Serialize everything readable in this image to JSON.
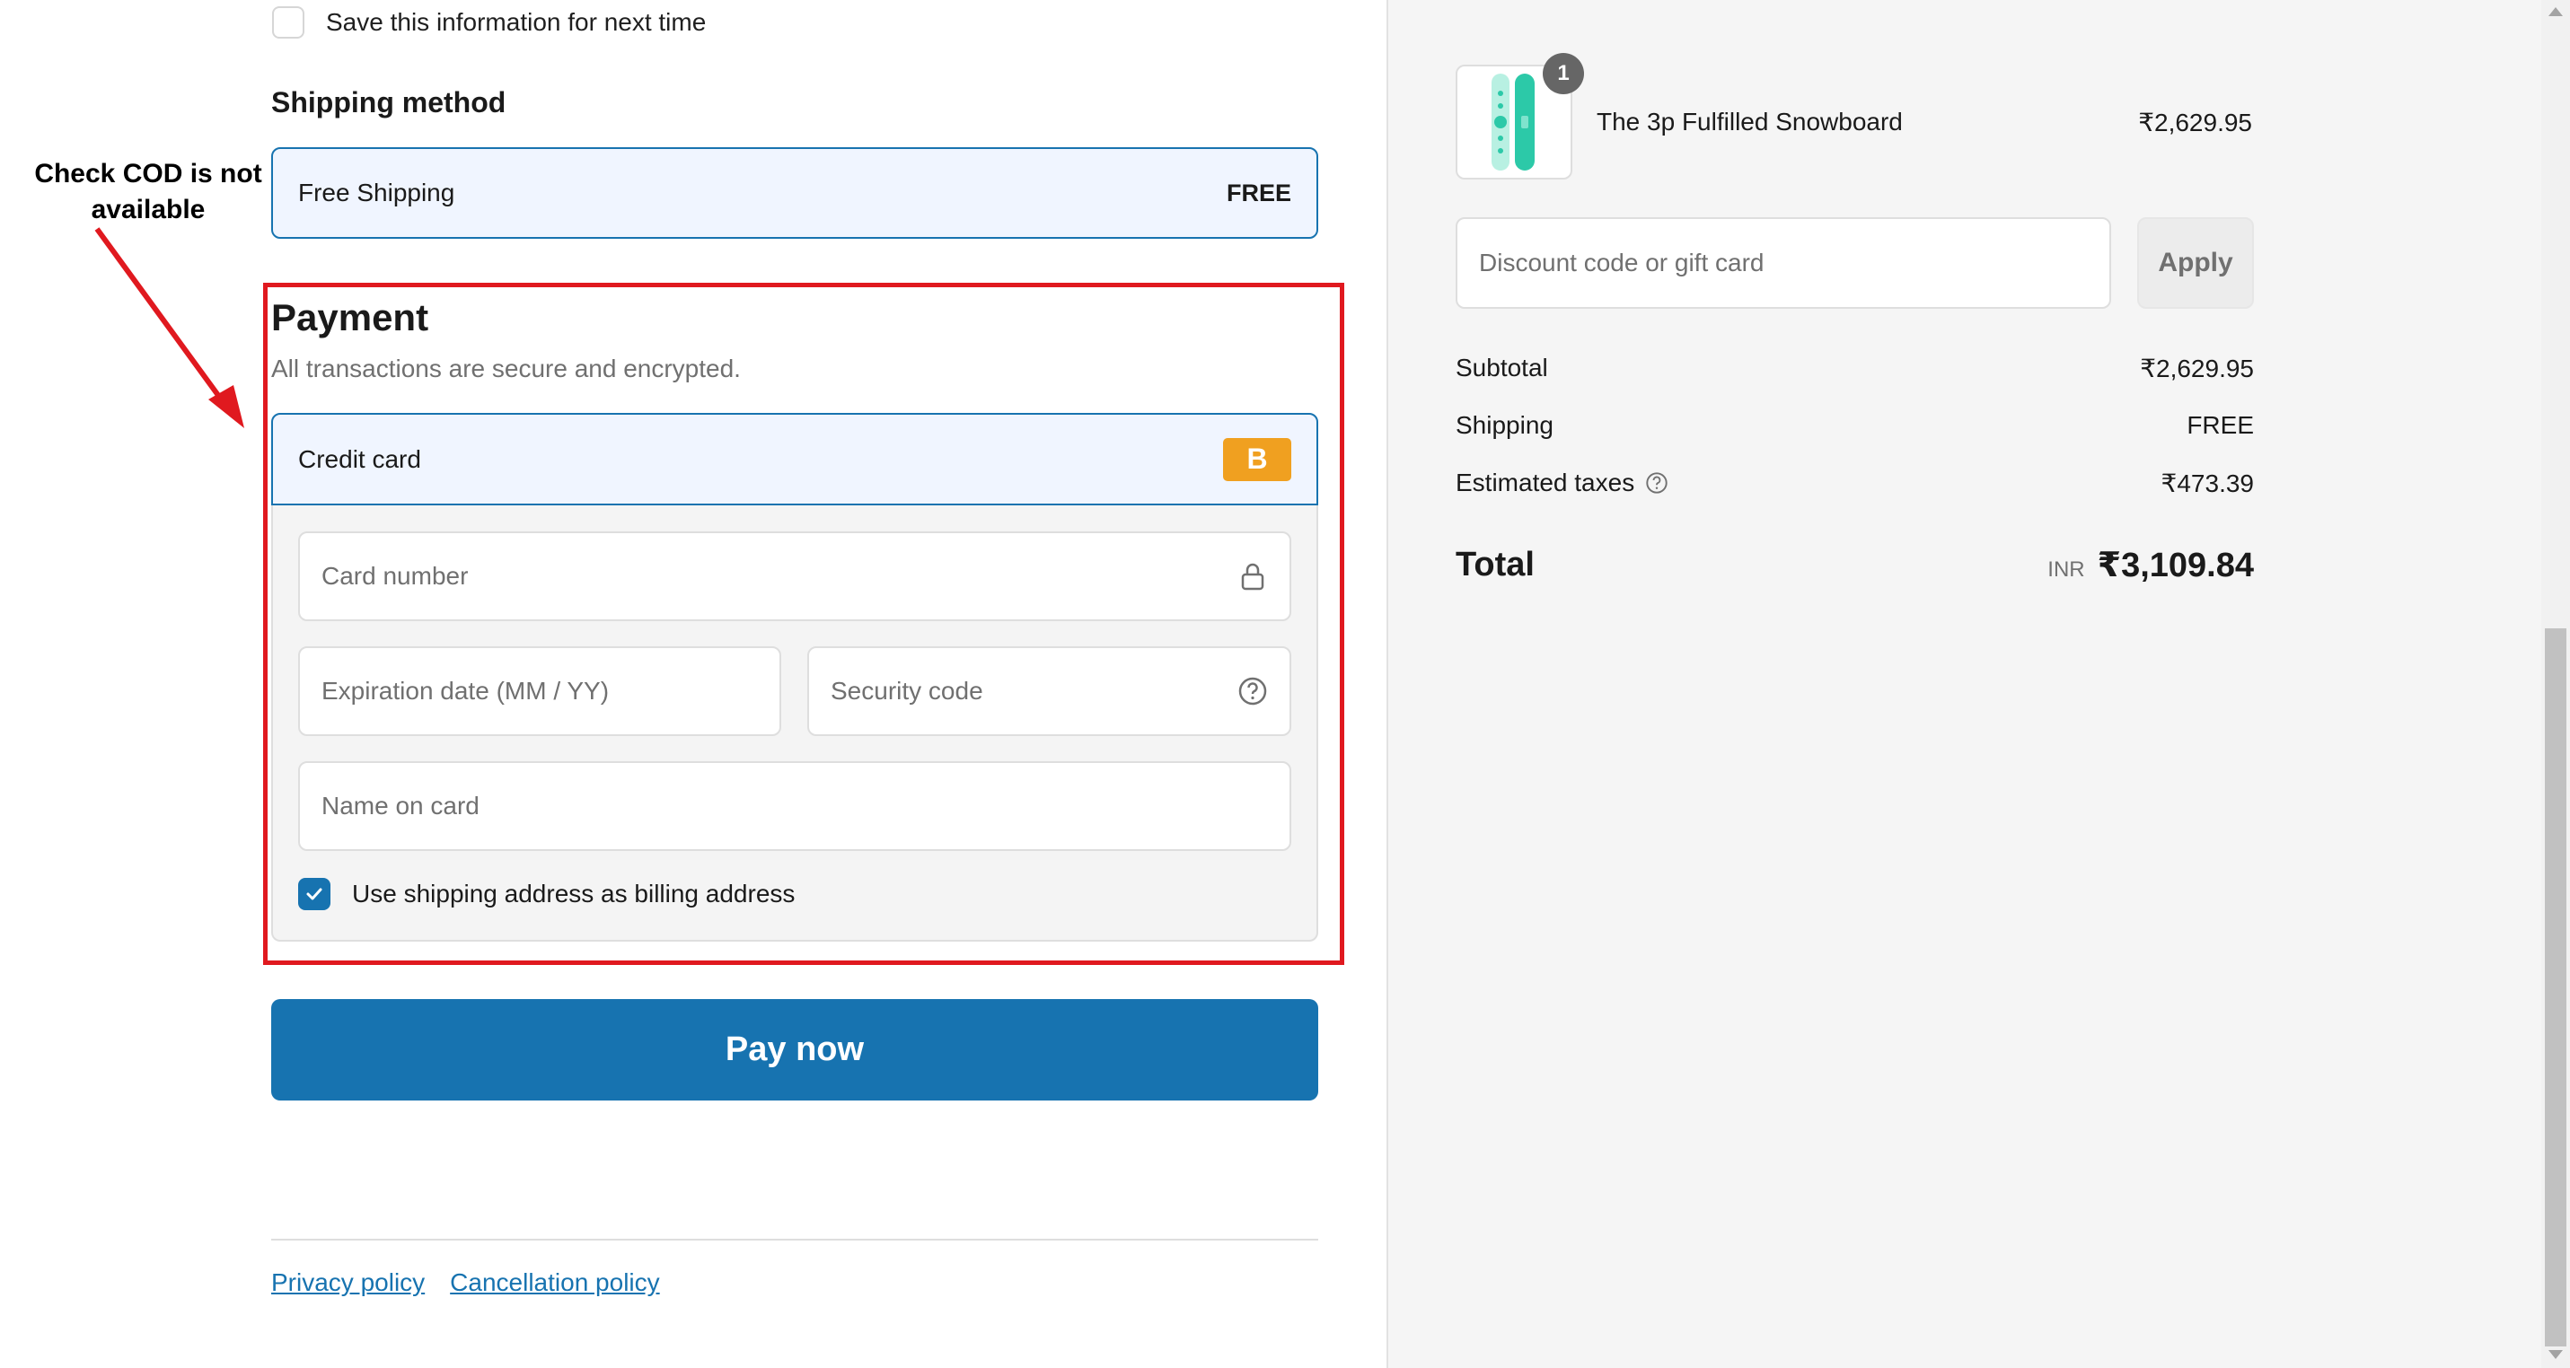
{
  "contact": {
    "save_info_label": "Save this information for next time"
  },
  "shipping_method": {
    "heading": "Shipping method",
    "option_name": "Free Shipping",
    "option_price": "FREE"
  },
  "annotation": {
    "text": "Check COD is not available",
    "color": "#e0191f"
  },
  "payment": {
    "heading": "Payment",
    "subtitle": "All transactions are secure and encrypted.",
    "method_label": "Credit card",
    "method_badge": "B",
    "card_number_placeholder": "Card number",
    "expiration_placeholder": "Expiration date (MM / YY)",
    "security_code_placeholder": "Security code",
    "name_placeholder": "Name on card",
    "billing_same_label": "Use shipping address as billing address",
    "billing_same_checked": true,
    "pay_button_label": "Pay now"
  },
  "footer": {
    "links": [
      "Privacy policy",
      "Cancellation policy"
    ]
  },
  "order_summary": {
    "product": {
      "title": "The 3p Fulfilled Snowboard",
      "price": "₹2,629.95",
      "quantity": "1"
    },
    "discount_placeholder": "Discount code or gift card",
    "apply_label": "Apply",
    "subtotal_label": "Subtotal",
    "subtotal_value": "₹2,629.95",
    "shipping_label": "Shipping",
    "shipping_value": "FREE",
    "taxes_label": "Estimated taxes",
    "taxes_value": "₹473.39",
    "total_label": "Total",
    "total_currency": "INR",
    "total_value": "₹3,109.84"
  },
  "colors": {
    "accent": "#1773b0",
    "badge": "#f0a020"
  }
}
